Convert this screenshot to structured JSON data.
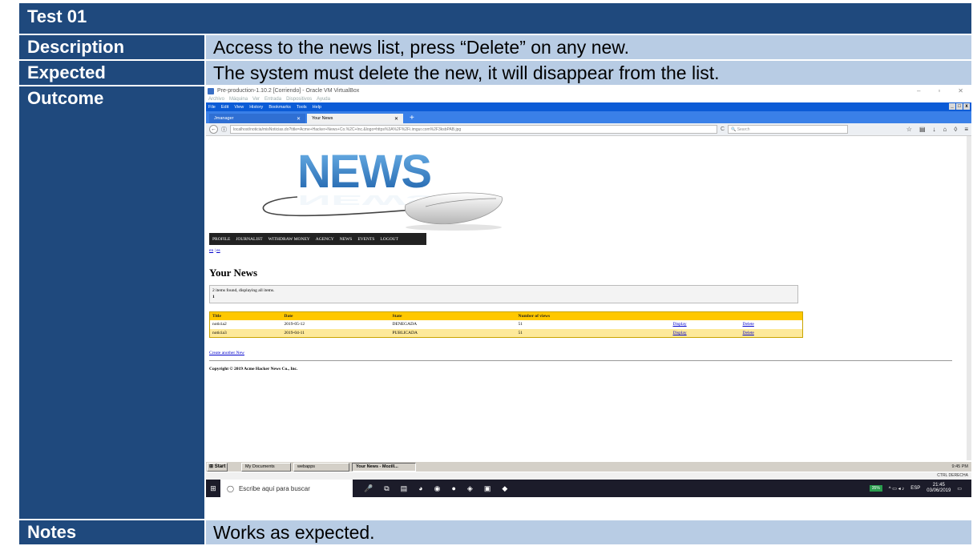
{
  "test_id": "Test 01",
  "rows": {
    "description_label": "Description",
    "description_value": "Access to the news list, press “Delete” on any new.",
    "expected_label": "Expected",
    "expected_value": "The system must delete the new, it will disappear from the list.",
    "outcome_label": "Outcome",
    "notes_label": "Notes",
    "notes_value": "Works as expected."
  },
  "screenshot": {
    "vbox_title": "Pre-production-1.10.2 [Corriendo] - Oracle VM VirtualBox",
    "vbox_menu": [
      "Archivo",
      "Máquina",
      "Ver",
      "Entrada",
      "Dispositivos",
      "Ayuda"
    ],
    "ff_menu": [
      "File",
      "Edit",
      "View",
      "History",
      "Bookmarks",
      "Tools",
      "Help"
    ],
    "tabs": [
      "Jmanager",
      "Your News"
    ],
    "url": "localhost/noticia/misNoticias.do?title=Acme+Hacker+News+Co.%2C+Inc.&logo=https%3A%2F%2Fi.imgur.com%2F3ksbPAB.jpg",
    "search_placeholder": "Search",
    "banner_text": "NEWS",
    "nav": [
      "PROFILE",
      "JOURNALIST",
      "WITHDRAW MONEY",
      "AGENCY",
      "NEWS",
      "EVENTS",
      "LOGOUT"
    ],
    "lang": {
      "en": "en",
      "sep": " | ",
      "es": "es"
    },
    "page_title": "Your News",
    "found_text": "2 items found, displaying all items.",
    "page_num": "1",
    "table": {
      "headers": [
        "Title",
        "Date",
        "State",
        "Number of views",
        "",
        ""
      ],
      "rows": [
        [
          "noticia2",
          "2019-05-12",
          "DENEGADA",
          "51",
          "Display",
          "Delete"
        ],
        [
          "noticia3",
          "2019-04-11",
          "PUBLICADA",
          "51",
          "Display",
          "Delete"
        ]
      ]
    },
    "create_link": "Create another New",
    "copyright": "Copyright © 2019 Acme Hacker News Co., Inc.",
    "xp_taskbar": {
      "start": "Start",
      "buttons": [
        "My Documents",
        "webapps",
        "Your News - Mozill..."
      ],
      "clock": "9:45 PM"
    },
    "vbox_status": "CTRL DERECHA",
    "win_taskbar": {
      "search": "Escribe aquí para buscar",
      "battery": "35%",
      "lang": "ESP",
      "time": "21:45",
      "date": "03/06/2019"
    }
  }
}
